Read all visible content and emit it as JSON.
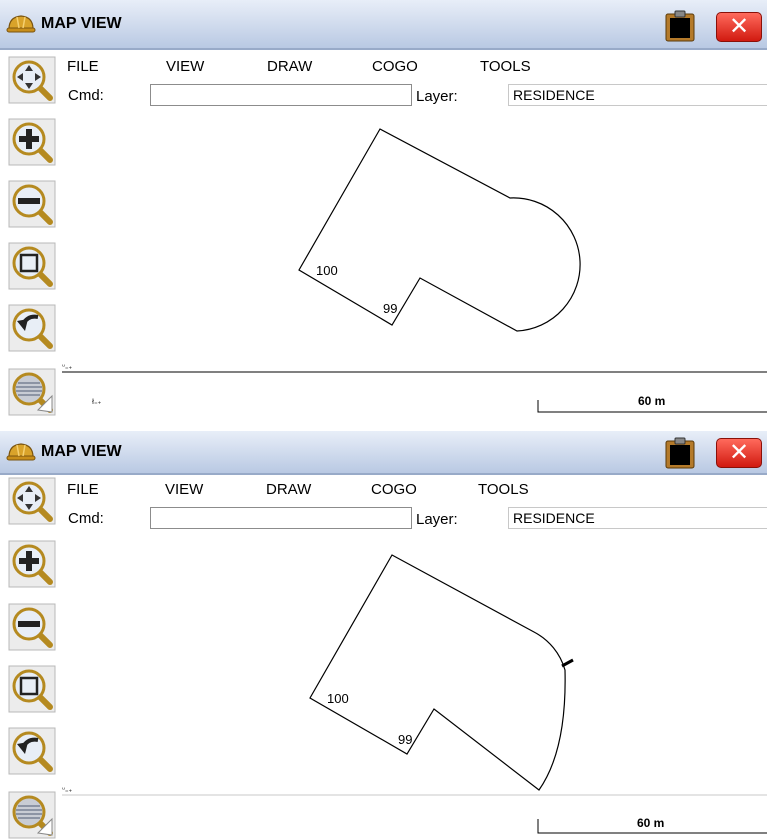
{
  "screens": [
    {
      "title": "MAP VIEW",
      "menu": [
        "FILE",
        "VIEW",
        "DRAW",
        "COGO",
        "TOOLS"
      ],
      "cmd_label": "Cmd:",
      "cmd_value": "",
      "layer_label": "Layer:",
      "layer_value": "RESIDENCE",
      "points": [
        "100",
        "99"
      ],
      "scale": "60 m"
    },
    {
      "title": "MAP VIEW",
      "menu": [
        "FILE",
        "VIEW",
        "DRAW",
        "COGO",
        "TOOLS"
      ],
      "cmd_label": "Cmd:",
      "cmd_value": "",
      "layer_label": "Layer:",
      "layer_value": "RESIDENCE",
      "points": [
        "100",
        "99"
      ],
      "scale": "60 m"
    }
  ],
  "toolbar_icons": [
    "pan-icon",
    "zoom-in-icon",
    "zoom-out-icon",
    "zoom-window-icon",
    "zoom-previous-icon",
    "zoom-extents-icon"
  ],
  "colors": {
    "titlebar": "#c3d1ea",
    "close": "#e0281c",
    "accent_gold": "#c8a030"
  }
}
